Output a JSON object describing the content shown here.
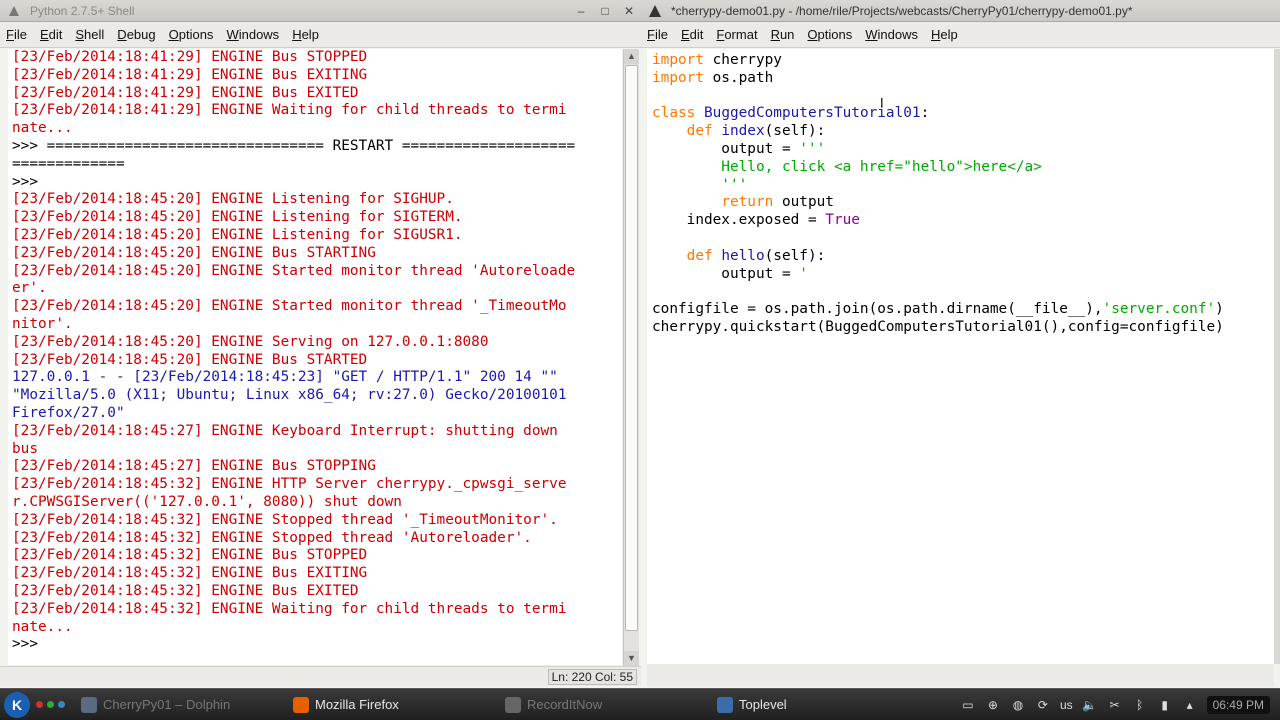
{
  "shell": {
    "title": "Python 2.7.5+ Shell",
    "menu": [
      "File",
      "Edit",
      "Shell",
      "Debug",
      "Options",
      "Windows",
      "Help"
    ],
    "status": "Ln: 220 Col: 55",
    "lines": [
      {
        "c": "red",
        "t": "[23/Feb/2014:18:41:29] ENGINE Bus STOPPED"
      },
      {
        "c": "red",
        "t": "[23/Feb/2014:18:41:29] ENGINE Bus EXITING"
      },
      {
        "c": "red",
        "t": "[23/Feb/2014:18:41:29] ENGINE Bus EXITED"
      },
      {
        "c": "red",
        "t": "[23/Feb/2014:18:41:29] ENGINE Waiting for child threads to termi"
      },
      {
        "c": "red",
        "t": "nate..."
      },
      {
        "c": "black",
        "t": ">>> ================================ RESTART ===================="
      },
      {
        "c": "black",
        "t": "============="
      },
      {
        "c": "black",
        "t": ">>>"
      },
      {
        "c": "red",
        "t": "[23/Feb/2014:18:45:20] ENGINE Listening for SIGHUP."
      },
      {
        "c": "red",
        "t": "[23/Feb/2014:18:45:20] ENGINE Listening for SIGTERM."
      },
      {
        "c": "red",
        "t": "[23/Feb/2014:18:45:20] ENGINE Listening for SIGUSR1."
      },
      {
        "c": "red",
        "t": "[23/Feb/2014:18:45:20] ENGINE Bus STARTING"
      },
      {
        "c": "red",
        "t": "[23/Feb/2014:18:45:20] ENGINE Started monitor thread 'Autoreloade"
      },
      {
        "c": "red",
        "t": "er'."
      },
      {
        "c": "red",
        "t": "[23/Feb/2014:18:45:20] ENGINE Started monitor thread '_TimeoutMo"
      },
      {
        "c": "red",
        "t": "nitor'."
      },
      {
        "c": "red",
        "t": "[23/Feb/2014:18:45:20] ENGINE Serving on 127.0.0.1:8080"
      },
      {
        "c": "red",
        "t": "[23/Feb/2014:18:45:20] ENGINE Bus STARTED"
      },
      {
        "c": "blue",
        "t": "127.0.0.1 - - [23/Feb/2014:18:45:23] \"GET / HTTP/1.1\" 200 14 \"\""
      },
      {
        "c": "blue",
        "t": "\"Mozilla/5.0 (X11; Ubuntu; Linux x86_64; rv:27.0) Gecko/20100101"
      },
      {
        "c": "blue",
        "t": "Firefox/27.0\""
      },
      {
        "c": "red",
        "t": "[23/Feb/2014:18:45:27] ENGINE Keyboard Interrupt: shutting down"
      },
      {
        "c": "red",
        "t": "bus"
      },
      {
        "c": "red",
        "t": "[23/Feb/2014:18:45:27] ENGINE Bus STOPPING"
      },
      {
        "c": "red",
        "t": "[23/Feb/2014:18:45:32] ENGINE HTTP Server cherrypy._cpwsgi_serve"
      },
      {
        "c": "red",
        "t": "r.CPWSGIServer(('127.0.0.1', 8080)) shut down"
      },
      {
        "c": "red",
        "t": "[23/Feb/2014:18:45:32] ENGINE Stopped thread '_TimeoutMonitor'."
      },
      {
        "c": "red",
        "t": "[23/Feb/2014:18:45:32] ENGINE Stopped thread 'Autoreloader'."
      },
      {
        "c": "red",
        "t": "[23/Feb/2014:18:45:32] ENGINE Bus STOPPED"
      },
      {
        "c": "red",
        "t": "[23/Feb/2014:18:45:32] ENGINE Bus EXITING"
      },
      {
        "c": "red",
        "t": "[23/Feb/2014:18:45:32] ENGINE Bus EXITED"
      },
      {
        "c": "red",
        "t": "[23/Feb/2014:18:45:32] ENGINE Waiting for child threads to termi"
      },
      {
        "c": "red",
        "t": "nate..."
      },
      {
        "c": "black",
        "t": ">>> "
      }
    ]
  },
  "editor": {
    "title": "*cherrypy-demo01.py - /home/rile/Projects/webcasts/CherryPy01/cherrypy-demo01.py*",
    "menu": [
      "File",
      "Edit",
      "Format",
      "Run",
      "Options",
      "Windows",
      "Help"
    ],
    "lines": [
      [
        {
          "c": "orange",
          "t": "import"
        },
        {
          "c": "black",
          "t": " cherrypy"
        }
      ],
      [
        {
          "c": "orange",
          "t": "import"
        },
        {
          "c": "black",
          "t": " os.path"
        }
      ],
      [],
      [
        {
          "c": "orange",
          "t": "class"
        },
        {
          "c": "blue",
          "t": " BuggedComputersTutorial01"
        },
        {
          "c": "black",
          "t": ":"
        }
      ],
      [
        {
          "c": "black",
          "t": "    "
        },
        {
          "c": "orange",
          "t": "def"
        },
        {
          "c": "blue",
          "t": " index"
        },
        {
          "c": "black",
          "t": "(self):"
        }
      ],
      [
        {
          "c": "black",
          "t": "        output = "
        },
        {
          "c": "green",
          "t": "'''"
        }
      ],
      [
        {
          "c": "green",
          "t": "        Hello, click <a href=\"hello\">here</a>"
        }
      ],
      [
        {
          "c": "green",
          "t": "        '''"
        }
      ],
      [
        {
          "c": "black",
          "t": "        "
        },
        {
          "c": "orange",
          "t": "return"
        },
        {
          "c": "black",
          "t": " output"
        }
      ],
      [
        {
          "c": "black",
          "t": "    index.exposed = "
        },
        {
          "c": "purple",
          "t": "True"
        }
      ],
      [],
      [
        {
          "c": "black",
          "t": "    "
        },
        {
          "c": "orange",
          "t": "def"
        },
        {
          "c": "blue",
          "t": " hello"
        },
        {
          "c": "black",
          "t": "(self):"
        }
      ],
      [
        {
          "c": "black",
          "t": "        output = "
        },
        {
          "c": "green",
          "t": "'"
        }
      ],
      [],
      [
        {
          "c": "black",
          "t": "configfile = os.path.join(os.path.dirname(__file__),"
        },
        {
          "c": "green",
          "t": "'server.conf'"
        },
        {
          "c": "black",
          "t": ")"
        }
      ],
      [
        {
          "c": "black",
          "t": "cherrypy.quickstart(BuggedComputersTutorial01(),config=configfile)"
        }
      ]
    ]
  },
  "taskbar": {
    "tasks": [
      {
        "label": "CherryPy01 – Dolphin",
        "active": false,
        "icon": "folder-icon",
        "color": "#5a6a80"
      },
      {
        "label": "Mozilla Firefox",
        "active": true,
        "icon": "firefox-icon",
        "color": "#e66000"
      },
      {
        "label": "RecordItNow",
        "active": false,
        "icon": "record-icon",
        "color": "#666666"
      },
      {
        "label": "Toplevel",
        "active": true,
        "icon": "idle-icon",
        "color": "#3b6ea8"
      }
    ],
    "tray_lang": "us",
    "clock": "06:49 PM"
  }
}
